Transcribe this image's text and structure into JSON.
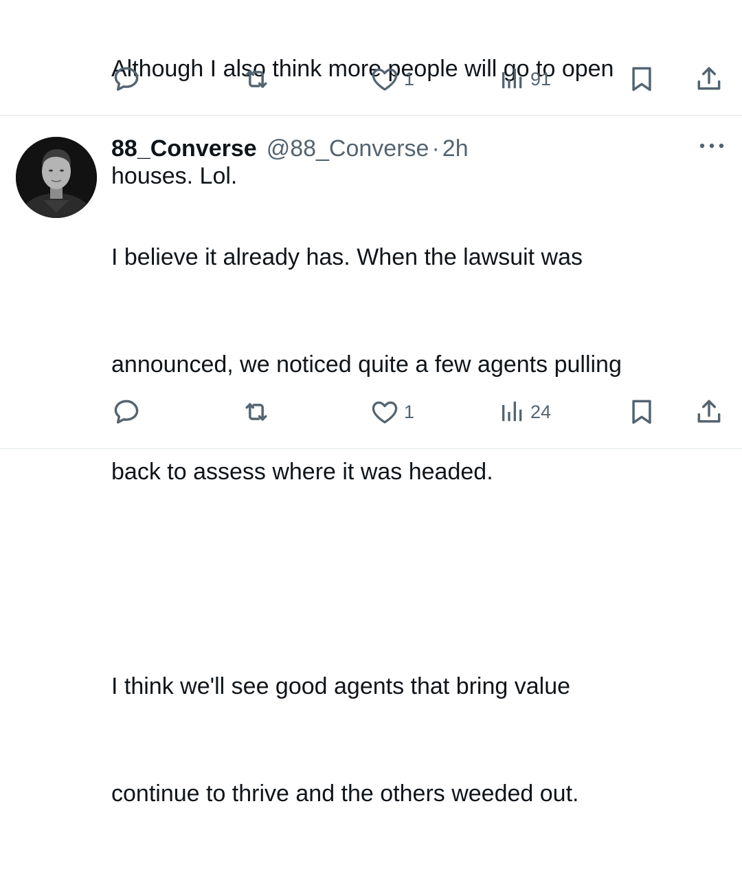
{
  "tweets": [
    {
      "text_lines": [
        "Although I also think more people will go to open",
        "houses. Lol."
      ],
      "actions": {
        "reply_count": "",
        "retweet_count": "",
        "like_count": "1",
        "view_count": "91"
      }
    },
    {
      "author": {
        "display_name": "88_Converse",
        "handle": "@88_Converse",
        "separator": "·",
        "timestamp": "2h"
      },
      "text_lines": [
        "I believe it already has. When the lawsuit was",
        "announced, we noticed quite a few agents pulling",
        "back to assess where it was headed.",
        "",
        "I think we'll see good agents that bring value",
        "continue to thrive and the others weeded out."
      ],
      "actions": {
        "reply_count": "",
        "retweet_count": "",
        "like_count": "1",
        "view_count": "24"
      }
    }
  ],
  "icons": {
    "reply": "speech-bubble-icon",
    "retweet": "retweet-arrows-icon",
    "like": "heart-icon",
    "views": "bar-chart-icon",
    "bookmark": "bookmark-icon",
    "share": "share-upload-icon",
    "more": "ellipsis-icon"
  },
  "colors": {
    "text_primary": "#0f1419",
    "text_secondary": "#536471",
    "divider": "#e1e5e8"
  }
}
